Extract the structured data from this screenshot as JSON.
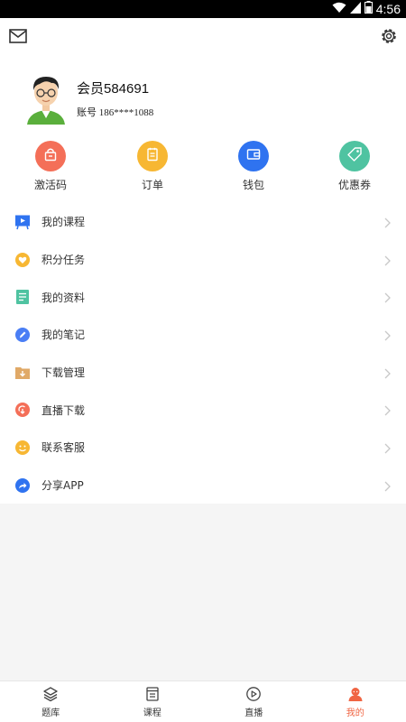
{
  "status_bar": {
    "time": "4:56"
  },
  "profile": {
    "username": "会员584691",
    "account": "账号 186****1088"
  },
  "quick_actions": [
    {
      "label": "激活码",
      "icon": "lock-bag-icon",
      "color": "#f46f58"
    },
    {
      "label": "订单",
      "icon": "clipboard-icon",
      "color": "#f7b733"
    },
    {
      "label": "钱包",
      "icon": "wallet-icon",
      "color": "#2f73f0"
    },
    {
      "label": "优惠券",
      "icon": "tag-icon",
      "color": "#4fc3a1"
    }
  ],
  "menu": [
    {
      "label": "我的课程",
      "icon": "course-board-icon",
      "color": "#2f73f0"
    },
    {
      "label": "积分任务",
      "icon": "heart-badge-icon",
      "color": "#f7b733"
    },
    {
      "label": "我的资料",
      "icon": "document-list-icon",
      "color": "#4fc3a1"
    },
    {
      "label": "我的笔记",
      "icon": "pencil-icon",
      "color": "#4a7ef5"
    },
    {
      "label": "下载管理",
      "icon": "download-folder-icon",
      "color": "#e0a967"
    },
    {
      "label": "直播下载",
      "icon": "live-download-icon",
      "color": "#f46f58"
    },
    {
      "label": "联系客服",
      "icon": "smiley-icon",
      "color": "#f7b733"
    },
    {
      "label": "分享APP",
      "icon": "share-icon",
      "color": "#2f73f0"
    }
  ],
  "tabs": [
    {
      "label": "题库",
      "icon": "layers-icon"
    },
    {
      "label": "课程",
      "icon": "book-icon"
    },
    {
      "label": "直播",
      "icon": "play-circle-icon"
    },
    {
      "label": "我的",
      "icon": "person-icon",
      "active": true
    }
  ],
  "colors": {
    "accent": "#f06543",
    "background": "#f5f5f5"
  }
}
